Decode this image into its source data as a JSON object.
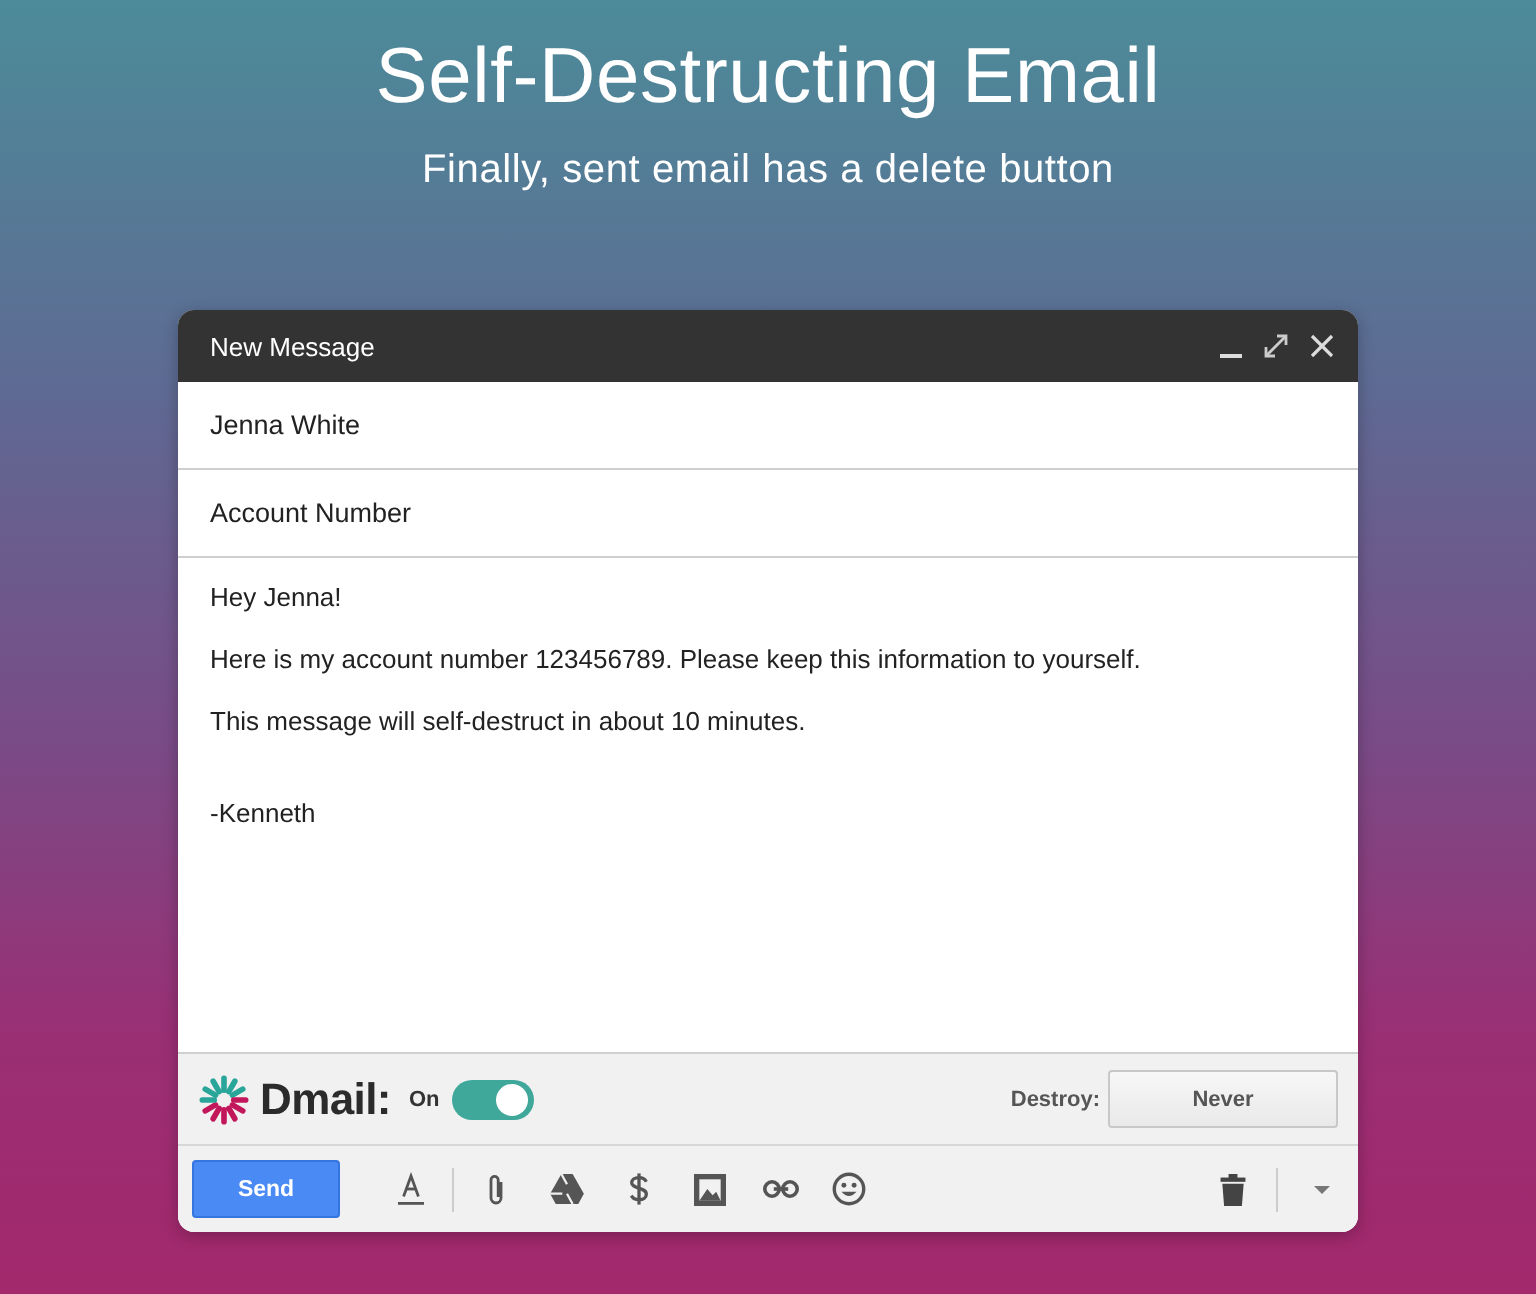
{
  "header": {
    "title": "Self-Destructing Email",
    "subtitle": "Finally, sent email has a delete button"
  },
  "compose": {
    "title": "New Message",
    "to": "Jenna White",
    "subject": "Account Number",
    "body": [
      "Hey Jenna!",
      "Here is my account number 123456789. Please keep this information to yourself.",
      "This message will self-destruct in about 10 minutes."
    ],
    "signature": "-Kenneth"
  },
  "dmail": {
    "brand": "Dmail:",
    "toggle": {
      "label": "On",
      "on": true
    },
    "destroy": {
      "label": "Destroy:",
      "value": "Never"
    }
  },
  "toolbar": {
    "send": "Send"
  }
}
